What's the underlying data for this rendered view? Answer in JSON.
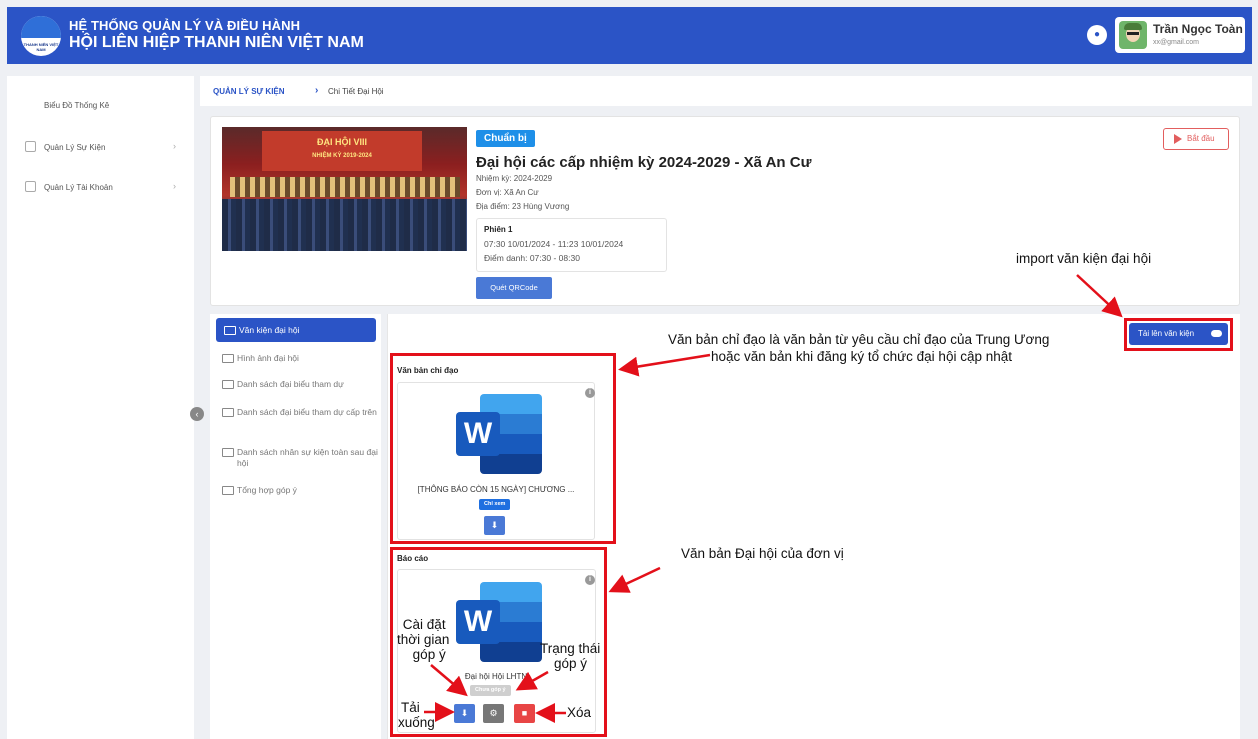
{
  "header": {
    "title_line1": "HỆ THỐNG QUẢN LÝ VÀ ĐIỀU HÀNH",
    "title_line2": "HỘI LIÊN HIỆP THANH NIÊN VIỆT NAM",
    "logo_text": "THANH NIÊN VIỆT NAM",
    "user_name": "Trần Ngọc Toàn",
    "user_email": "xx@gmail.com"
  },
  "sidebar": {
    "items": [
      {
        "label": "Biểu Đồ Thống Kê"
      },
      {
        "label": "Quản Lý Sự Kiện"
      },
      {
        "label": "Quản Lý Tài Khoản"
      }
    ]
  },
  "breadcrumb": {
    "root": "QUẢN LÝ SỰ KIỆN",
    "current": "Chi Tiết Đại Hội"
  },
  "event": {
    "image_banner": "ĐẠI HỘI VIII",
    "image_sub": "NHIỆM KỲ 2019-2024",
    "status": "Chuẩn bị",
    "start_label": "Bắt đầu",
    "title": "Đại hội các cấp nhiệm kỳ 2024-2029 - Xã An Cư",
    "term": "Nhiệm kỳ: 2024-2029",
    "unit": "Đơn vị: Xã An Cư",
    "location": "Địa điểm: 23 Hùng Vương",
    "session": {
      "name": "Phiên 1",
      "time": "07:30 10/01/2024 - 11:23 10/01/2024",
      "checkin": "Điểm danh: 07:30 - 08:30"
    },
    "qr_label": "Quét QRCode"
  },
  "folders": [
    {
      "label": "Văn kiện đại hội"
    },
    {
      "label": "Hình ảnh đại hội"
    },
    {
      "label": "Danh sách đại biểu tham dự"
    },
    {
      "label": "Danh sách đại biểu tham dự cấp trên"
    },
    {
      "label": "Danh sách nhân sự kiện toàn sau đại hội"
    },
    {
      "label": "Tổng hợp góp ý"
    }
  ],
  "upload_label": "Tải lên văn kiện",
  "sections": {
    "directive": {
      "title": "Văn bản chỉ đạo",
      "doc_name": "[THÔNG BÁO CÒN 15 NGÀY] CHƯƠNG ...",
      "badge": "Chỉ xem"
    },
    "report": {
      "title": "Báo cáo",
      "doc_name": "Đại hội Hội LHTN",
      "badge": "Chưa góp ý"
    }
  },
  "annotations": {
    "import": "import văn kiện đại hội",
    "directive_line1": "Văn bản chỉ đạo là văn bản từ yêu cầu chỉ đạo của Trung Ương",
    "directive_line2": "hoặc văn bản khi đăng ký tổ chức đại hội cập nhật",
    "report": "Văn bản Đại hội của đơn vị",
    "settings_line1": "Cài đặt",
    "settings_line2": "thời gian",
    "settings_line3": "góp ý",
    "status_line1": "Trạng thái",
    "status_line2": "góp ý",
    "download_line1": "Tải",
    "download_line2": "xuống",
    "delete": "Xóa"
  },
  "colors": {
    "primary": "#2b54c6",
    "status_badge": "#1e8fe8",
    "danger": "#e25e5e",
    "annotation_red": "#e3101a",
    "download_btn": "#4a79d6",
    "settings_btn": "#777777",
    "delete_btn": "#e84545"
  },
  "icons": [
    "bell-icon",
    "folder-icon",
    "info-icon",
    "word-icon",
    "download-icon",
    "gear-icon",
    "trash-icon",
    "cloud-upload-icon",
    "play-icon",
    "chevron-right-icon",
    "collapse-left-icon"
  ]
}
